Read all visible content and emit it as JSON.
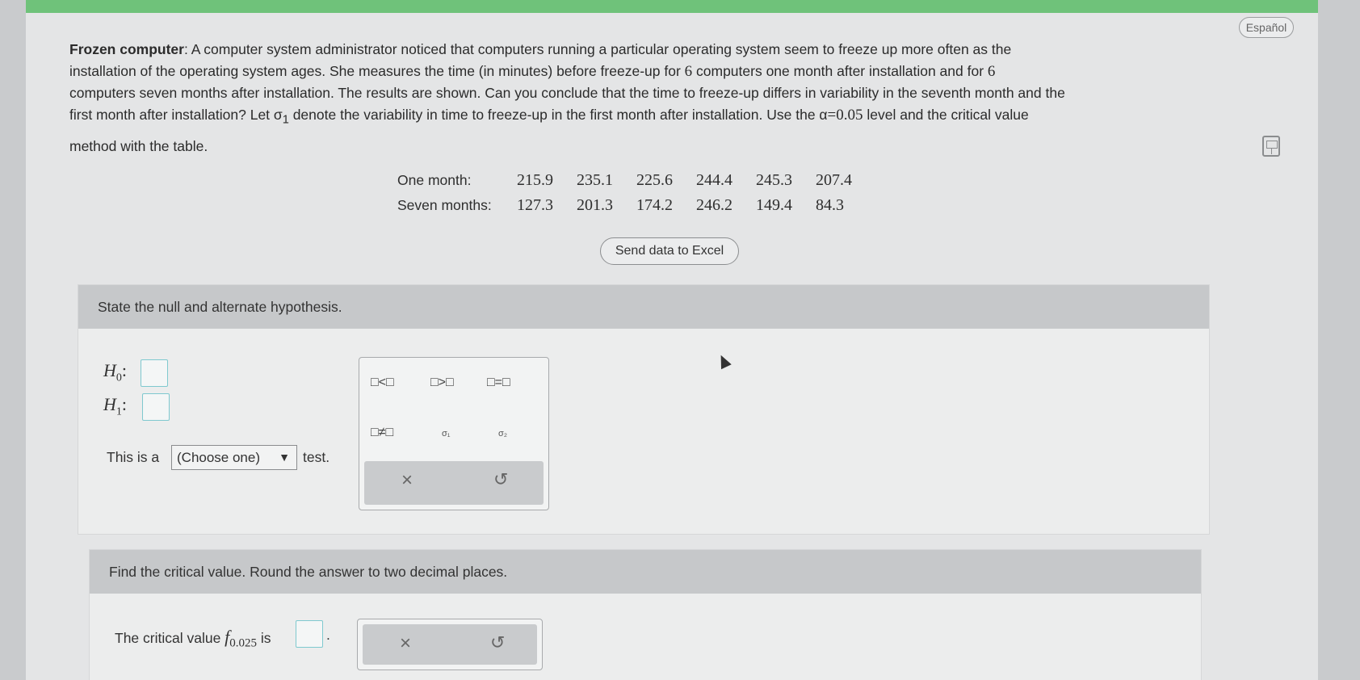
{
  "header": {
    "language_button": "Español"
  },
  "problem": {
    "title": "Frozen computer",
    "line1": ": A computer system administrator noticed that computers running a particular operating system seem to freeze up more often as the",
    "line2a": "installation of the operating system ages. She measures the time (in minutes) before freeze-up for ",
    "line2n": "6",
    "line2b": " computers one month after installation and for ",
    "line2n2": "6",
    "line3": "computers seven months after installation. The results are shown. Can you conclude that the time to freeze-up differs in variability in the seventh month and the",
    "line4a": "first month after installation? Let σ",
    "line4sub": "1",
    "line4b": " denote the variability in time to freeze-up in the first month after installation. Use the α",
    "line4eq": "=0.05",
    "line4c": " level and the critical value",
    "line5": "method with the table."
  },
  "data_table": {
    "rows": [
      {
        "label": "One month:",
        "values": [
          "215.9",
          "235.1",
          "225.6",
          "244.4",
          "245.3",
          "207.4"
        ]
      },
      {
        "label": "Seven months:",
        "values": [
          "127.3",
          "201.3",
          "174.2",
          "246.2",
          "149.4",
          "84.3"
        ]
      }
    ]
  },
  "excel_button": "Send data to Excel",
  "section1": {
    "header": "State the null and alternate hypothesis.",
    "h0_label": "H",
    "h0_sub": "0",
    "h1_label": "H",
    "h1_sub": "1",
    "colon": ":",
    "test_prefix": "This is a",
    "select_value": "(Choose one)",
    "select_arrow": "▼",
    "test_suffix": "test.",
    "palette": {
      "lt": "□<□",
      "gt": "□>□",
      "eq": "□=□",
      "ne": "□≠□",
      "sigma1": "σ₁",
      "sigma2": "σ₂",
      "clear": "×",
      "undo": "↺"
    }
  },
  "section2": {
    "header": "Find the critical value. Round the answer to two decimal places.",
    "crit_prefix": "The critical value ",
    "crit_f": "f",
    "crit_sub": "0.025",
    "crit_is": " is",
    "crit_period": ".",
    "clear": "×",
    "undo": "↺"
  }
}
